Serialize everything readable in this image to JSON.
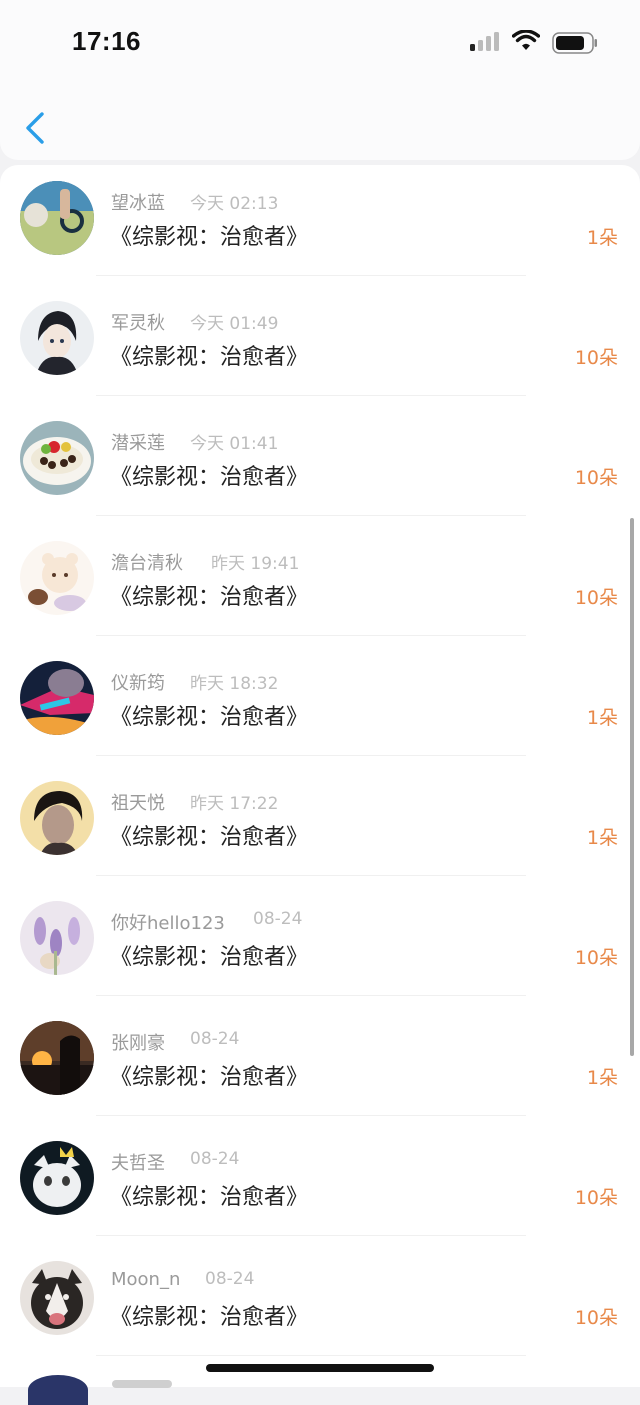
{
  "status_bar": {
    "time": "17:16"
  },
  "messages": [
    {
      "name": "望冰蓝",
      "time": "今天 02:13",
      "book": "《综影视：治愈者》",
      "count": "1朵",
      "avatar_icon": "avatar-photo-icon"
    },
    {
      "name": "军灵秋",
      "time": "今天 01:49",
      "book": "《综影视：治愈者》",
      "count": "10朵",
      "avatar_icon": "avatar-anime-icon"
    },
    {
      "name": "潜采莲",
      "time": "今天 01:41",
      "book": "《综影视：治愈者》",
      "count": "10朵",
      "avatar_icon": "avatar-food-icon"
    },
    {
      "name": "澹台清秋",
      "time": "昨天 19:41",
      "book": "《综影视：治愈者》",
      "count": "10朵",
      "avatar_icon": "avatar-bear-icon"
    },
    {
      "name": "仪新筠",
      "time": "昨天 18:32",
      "book": "《综影视：治愈者》",
      "count": "1朵",
      "avatar_icon": "avatar-game-icon"
    },
    {
      "name": "祖天悦",
      "time": "昨天 17:22",
      "book": "《综影视：治愈者》",
      "count": "1朵",
      "avatar_icon": "avatar-portrait-icon"
    },
    {
      "name": "你好hello123",
      "time": "08-24",
      "book": "《综影视：治愈者》",
      "count": "10朵",
      "avatar_icon": "avatar-lavender-icon"
    },
    {
      "name": "张刚豪",
      "time": "08-24",
      "book": "《综影视：治愈者》",
      "count": "1朵",
      "avatar_icon": "avatar-sunset-icon"
    },
    {
      "name": "夫哲圣",
      "time": "08-24",
      "book": "《综影视：治愈者》",
      "count": "10朵",
      "avatar_icon": "avatar-cat-icon"
    },
    {
      "name": "Moon_n",
      "time": "08-24",
      "book": "《综影视：治愈者》",
      "count": "10朵",
      "avatar_icon": "avatar-husky-icon"
    }
  ],
  "colors": {
    "accent": "#e8894a",
    "back": "#2a9ee8",
    "name": "#9a9a9a",
    "time": "#bdbdbd"
  }
}
